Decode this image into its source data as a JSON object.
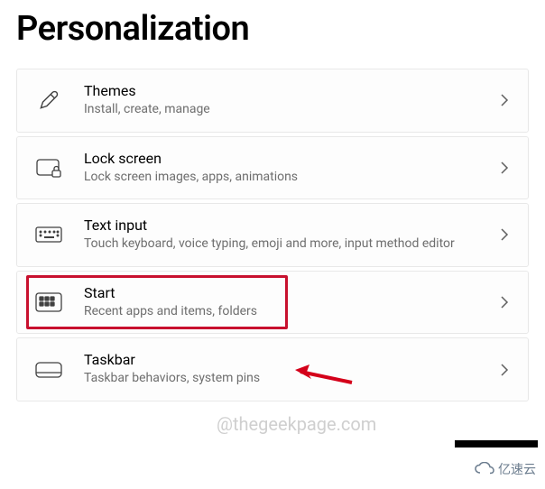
{
  "page_title": "Personalization",
  "items": [
    {
      "title": "Themes",
      "subtitle": "Install, create, manage"
    },
    {
      "title": "Lock screen",
      "subtitle": "Lock screen images, apps, animations"
    },
    {
      "title": "Text input",
      "subtitle": "Touch keyboard, voice typing, emoji and more, input method editor"
    },
    {
      "title": "Start",
      "subtitle": "Recent apps and items, folders"
    },
    {
      "title": "Taskbar",
      "subtitle": "Taskbar behaviors, system pins"
    }
  ],
  "watermark_text": "@thegeekpage.com",
  "watermark_logo": "亿速云",
  "annotations": {
    "highlight_color": "#c8102e",
    "arrow_color": "#d4001a"
  }
}
